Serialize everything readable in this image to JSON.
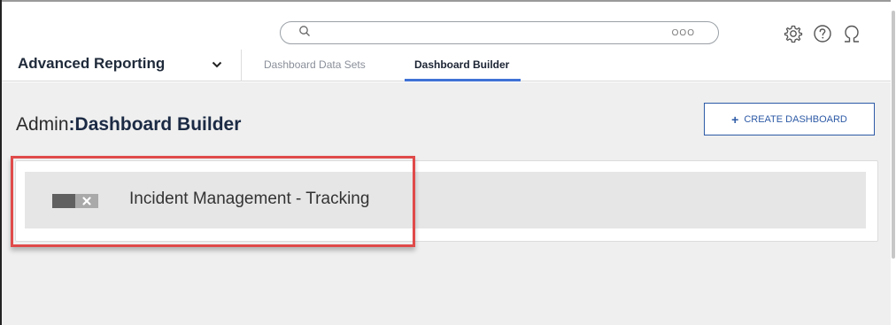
{
  "search": {
    "placeholder": "",
    "more_label": "OOO"
  },
  "header_icons": {
    "settings": "gear-icon",
    "help": "help-icon",
    "profile": "user-icon"
  },
  "nav": {
    "module": "Advanced Reporting",
    "tabs": [
      {
        "label": "Dashboard Data Sets",
        "active": false
      },
      {
        "label": "Dashboard Builder",
        "active": true
      }
    ]
  },
  "page": {
    "title_prefix": "Admin",
    "title_separator": ":",
    "title_name": "Dashboard Builder",
    "create_button": "CREATE DASHBOARD",
    "create_plus": "+"
  },
  "dashboards": [
    {
      "name": "Incident Management - Tracking",
      "enabled": false
    }
  ],
  "colors": {
    "accent": "#3f72d6",
    "button_border": "#2d5aa6",
    "highlight": "#e04a4a"
  }
}
